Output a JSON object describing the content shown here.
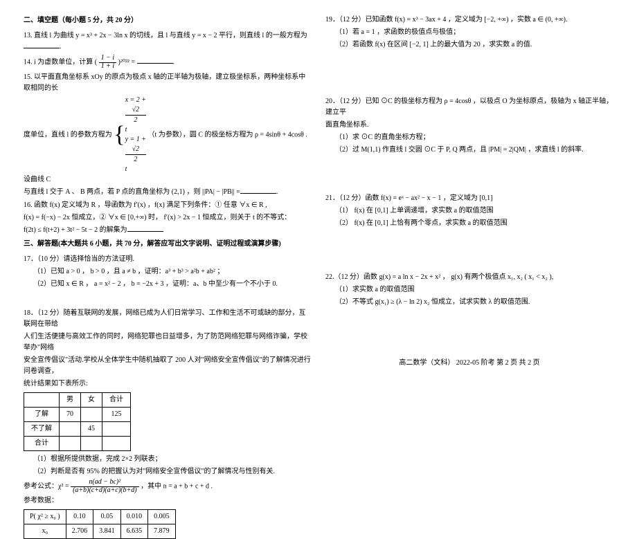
{
  "left": {
    "section2_title": "二、填空题（每小题 5 分，共 20 分）",
    "q13": "13. 直线 l 为曲线 y = x³ + 2x − 3ln x 的切线，且 l 与直线 y = x − 2 平行，则直线 l 的一般方程为",
    "q14_a": "14.  i 为虚数单位，计算 (",
    "q14_frac_num": "1 − i",
    "q14_frac_den": "1 + i",
    "q14_b": ")²⁰²² =",
    "q15_a": "15. 以平面直角坐标系 xOy 的原点为极点 x 轴的正半轴为极轴，建立极坐标系，两种坐标系中取相同的长",
    "q15_b": "度单位，直线 l 的参数方程为",
    "q15_line1_a": "x = 2 + ",
    "q15_line1_num": "√2",
    "q15_line1_den": "2",
    "q15_line1_b": " t",
    "q15_line2_a": "y = 1 + ",
    "q15_line2_num": "√2",
    "q15_line2_den": "2",
    "q15_line2_b": " t",
    "q15_c": "（t 为参数），圆 C 的极坐标方程为 ρ = 4sinθ + 4cosθ . 设曲线 C",
    "q15_d": "与直线 l 交于 A 、 B 两点，若 P 点的直角坐标为 (2,1) ，则 ||PA| − |PB|| =",
    "q16_a": "16.  函数 f(x) 定义域为 R ，导函数为 f′(x) ，f(x) 满足下列条件：① 任意 ∀x ∈ R ,",
    "q16_b": "f(x) = f(−x) − 2x 恒成立，② ∀x ∈ [0,+∞) 时， f′(x) > 2x − 1 恒成立，则关于 t 的不等式：",
    "q16_c": "f(2t) ≤ f(t+2) + 3t² − 5t − 2 的解集为",
    "section3_title": "三、解答题(本大题共 6 小题，共 70 分，解答应写出文字说明、证明过程或演算步骤)",
    "q17_h": "17．（10 分）请选择恰当的方法证明.",
    "q17_1": "（1）已知 a > 0 ， b > 0 ，且 a ≠ b ，证明：a³ + b³ > a²b + ab² ；",
    "q17_2": "（2）已知 x ∈ R ， a = x² − 2 ， b = −2x + 3 ，证明：a、b 中至少有一个不小于 0.",
    "q18_a": "18．（12 分）随着互联网的发展，网络已成为人们日常学习、工作和生活不可或缺的部分，互联网在带给",
    "q18_b": "人们生活便捷与高效工作的同时，网络犯罪也日益增多，为了防范网络犯罪与网络诈骗，学校举办\"网络",
    "q18_c": "安全宣传倡议\"活动.学校从全体学生中随机抽取了 200 人对\"网络安全宣传倡议\"的了解情况进行问卷调查，",
    "q18_d": "统计结果如下表所示:",
    "tbl1": {
      "h1": "",
      "h2": "男",
      "h3": "女",
      "h4": "合计",
      "r1c1": "了解",
      "r1c2": "70",
      "r1c3": "",
      "r1c4": "125",
      "r2c1": "不了解",
      "r2c2": "",
      "r2c3": "45",
      "r2c4": "",
      "r3c1": "合计",
      "r3c2": "",
      "r3c3": "",
      "r3c4": ""
    },
    "q18_e": "（1）根据所提供数据，完成 2×2 列联表；",
    "q18_f": "（2）判断是否有 95% 的把握认为对\"网络安全宣传倡议\"的了解情况与性别有关.",
    "chi_a": "参考公式：χ² = ",
    "chi_num": "n(ad − bc)²",
    "chi_den": "(a+b)(c+d)(a+c)(b+d)",
    "chi_b": " ，其中 n = a + b + c + d .",
    "chi_ref": "参考数据：",
    "tbl2": {
      "h1": "P( χ² ≥ x₀ )",
      "c1": "0.10",
      "c2": "0.05",
      "c3": "0.010",
      "c4": "0.005",
      "h2": "x₀",
      "d1": "2.706",
      "d2": "3.841",
      "d3": "6.635",
      "d4": "7.879"
    }
  },
  "right": {
    "q19_h": "19．（12 分）已知函数 f(x) = x³ − 3ax + 4 ，定义域为 [−2, +∞) ，实数 a ∈ (0, +∞).",
    "q19_1": "（1）若 a = 1 ，求函数的极值点与极值；",
    "q19_2": "（2）若函数 f(x) 在区间 [−2, 1] 上的最大值为 20 ，求实数 a 的值.",
    "q20_h": "20．（12 分）已知 ⊙C 的极坐标方程为 ρ = 4cosθ ，以极点 O 为坐标原点，极轴为 x 轴正半轴，建立平",
    "q20_h2": "面直角坐标系.",
    "q20_1": "（1）求 ⊙C 的直角坐标方程；",
    "q20_2": "（2）过 M(1,1) 作直线 l 交圆 ⊙C 于 P, Q 两点，且 |PM| = 2|QM| ，求直线 l 的斜率.",
    "q21_h": "21．（12 分）函数 f(x) = eˣ − ax² − x − 1 ，定义域为 [0,1]",
    "q21_1": "（1） f(x) 在 [0,1] 上单调递增，求实数 a 的取值范围",
    "q21_2": "（2） f(x) 在 [0,1] 上恰有两个零点，求实数 a 的取值范围",
    "q22_h": "22.（12 分）函数 g(x) = a ln x − 2x + x² ， g(x) 有两个极值点 x₁, x₂ ( x₁ < x₂ ),",
    "q22_1": "（1）求实数 a 的取值范围",
    "q22_2": "（2）不等式 g(x₁) ≥ (λ − ln 2) x₂ 恒成立，试求实数 λ 的取值范围.",
    "footer": "高二数学（文科）  2022-05 阶考  第 2 页   共 2 页"
  }
}
